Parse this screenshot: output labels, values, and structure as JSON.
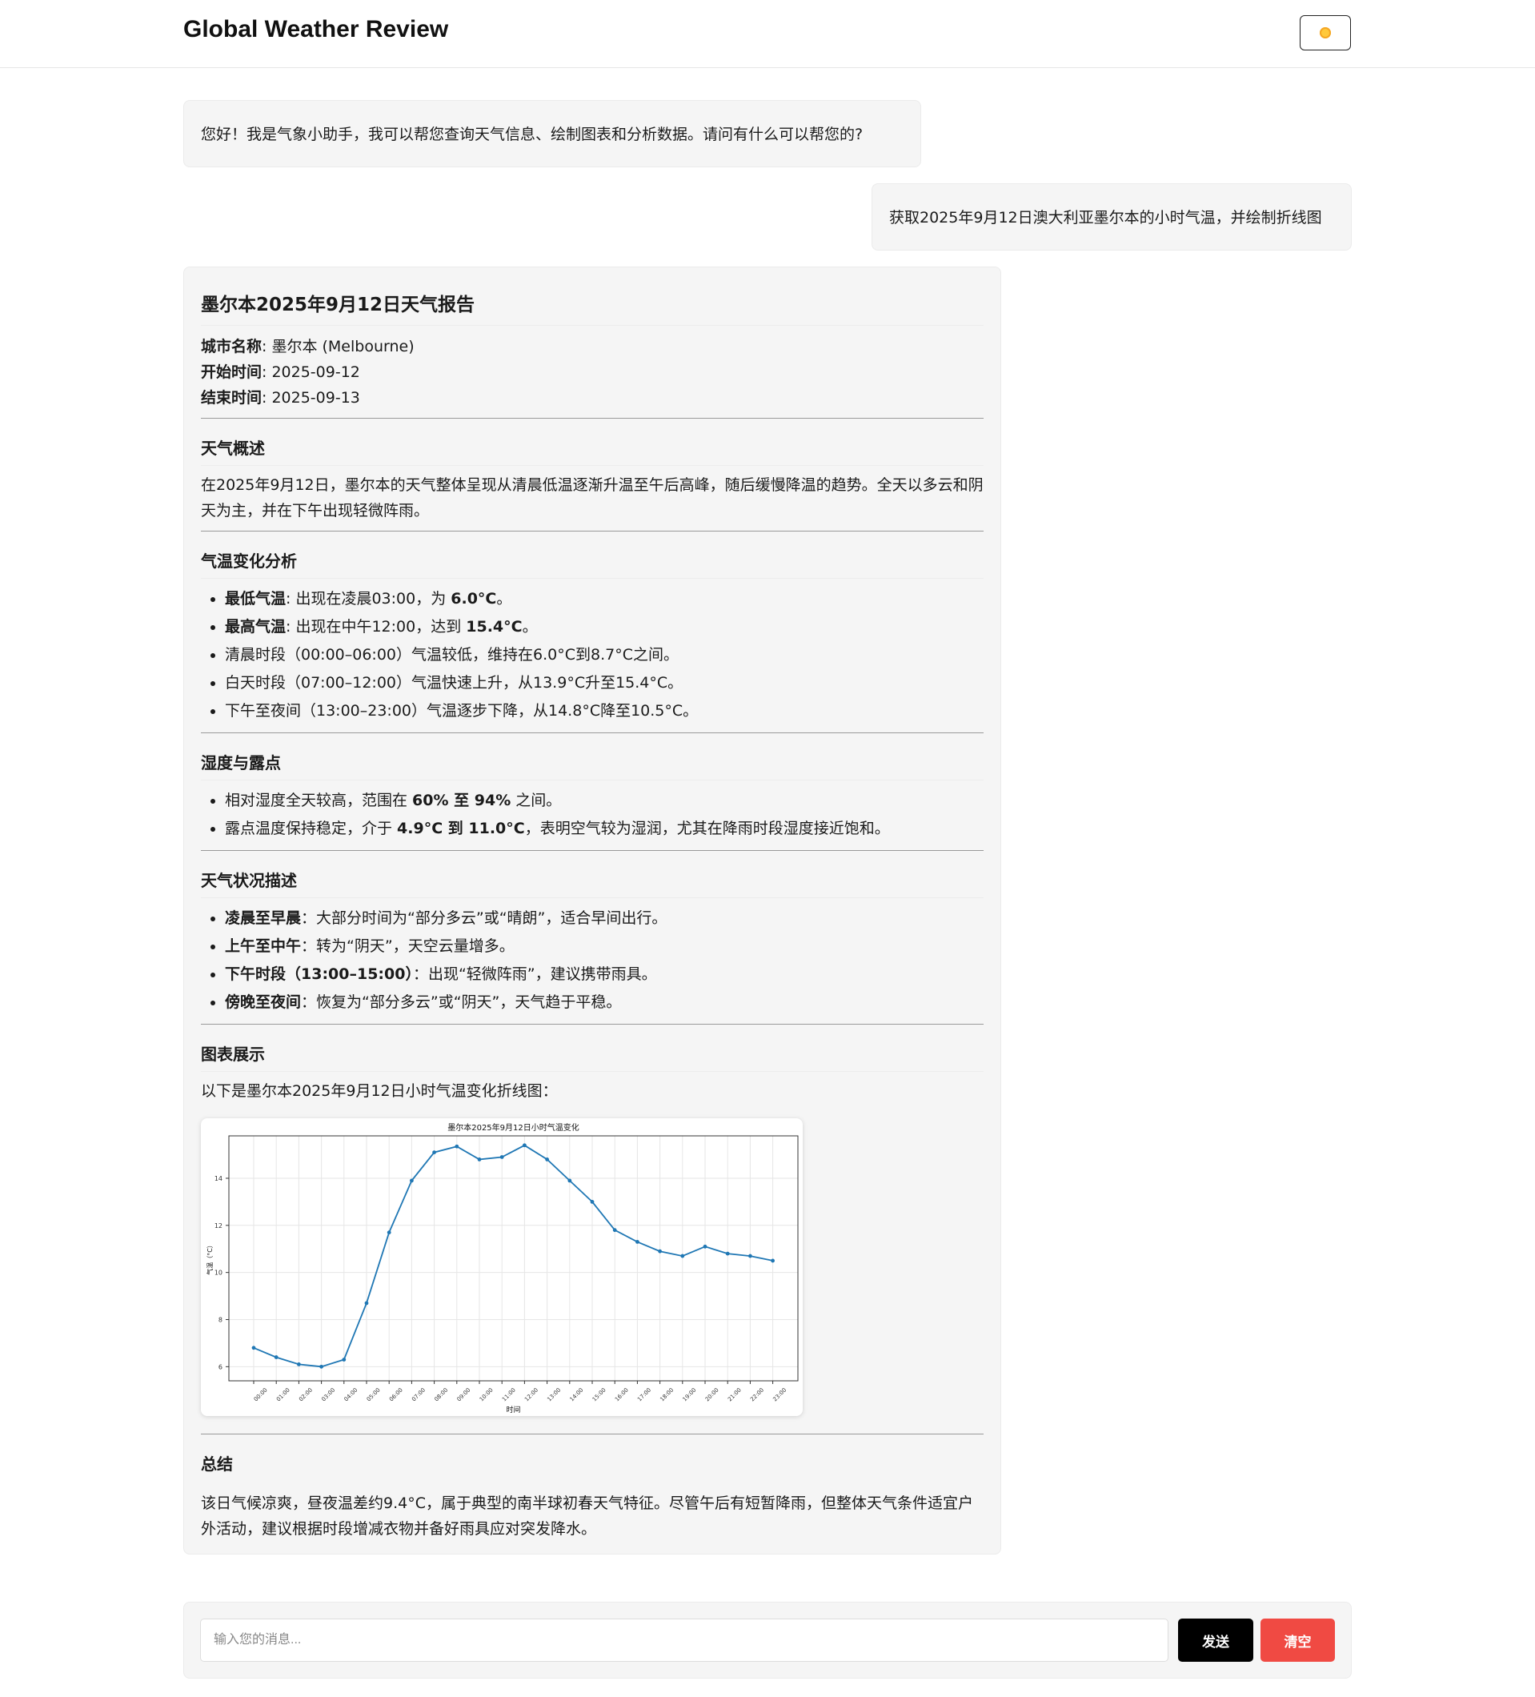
{
  "header": {
    "title": "Global Weather Review",
    "theme_icon": "sun-icon"
  },
  "messages": {
    "assistant_greeting": "您好！我是气象小助手，我可以帮您查询天气信息、绘制图表和分析数据。请问有什么可以帮您的?",
    "user_query": "获取2025年9月12日澳大利亚墨尔本的小时气温，并绘制折线图"
  },
  "report": {
    "title": "墨尔本2025年9月12日天气报告",
    "meta": [
      {
        "label": "城市名称",
        "value": ": 墨尔本 (Melbourne)"
      },
      {
        "label": "开始时间",
        "value": ": 2025-09-12"
      },
      {
        "label": "结束时间",
        "value": ": 2025-09-13"
      }
    ],
    "overview": {
      "title": "天气概述",
      "text": "在2025年9月12日，墨尔本的天气整体呈现从清晨低温逐渐升温至午后高峰，随后缓慢降温的趋势。全天以多云和阴天为主，并在下午出现轻微阵雨。"
    },
    "temperature": {
      "title": "气温变化分析",
      "items": [
        {
          "bold": "最低气温",
          "text": ": 出现在凌晨03:00，为 ",
          "bold2": "6.0°C",
          "tail": "。"
        },
        {
          "bold": "最高气温",
          "text": ": 出现在中午12:00，达到 ",
          "bold2": "15.4°C",
          "tail": "。"
        },
        {
          "bold": "",
          "text": "清晨时段（00:00–06:00）气温较低，维持在6.0°C到8.7°C之间。",
          "bold2": "",
          "tail": ""
        },
        {
          "bold": "",
          "text": "白天时段（07:00–12:00）气温快速上升，从13.9°C升至15.4°C。",
          "bold2": "",
          "tail": ""
        },
        {
          "bold": "",
          "text": "下午至夜间（13:00–23:00）气温逐步下降，从14.8°C降至10.5°C。",
          "bold2": "",
          "tail": ""
        }
      ]
    },
    "humidity": {
      "title": "湿度与露点",
      "items": [
        {
          "pre": "相对湿度全天较高，范围在 ",
          "bold": "60% 至 94%",
          "tail": " 之间。"
        },
        {
          "pre": "露点温度保持稳定，介于 ",
          "bold": "4.9°C 到 11.0°C",
          "tail": "，表明空气较为湿润，尤其在降雨时段湿度接近饱和。"
        }
      ]
    },
    "conditions": {
      "title": "天气状况描述",
      "items": [
        {
          "bold": "凌晨至早晨",
          "text": "：大部分时间为“部分多云”或“晴朗”，适合早间出行。"
        },
        {
          "bold": "上午至中午",
          "text": "：转为“阴天”，天空云量增多。"
        },
        {
          "bold": "下午时段（13:00–15:00）",
          "text": "：出现“轻微阵雨”，建议携带雨具。"
        },
        {
          "bold": "傍晚至夜间",
          "text": "：恢复为“部分多云”或“阴天”，天气趋于平稳。"
        }
      ]
    },
    "chart_section": {
      "title": "图表展示",
      "intro": "以下是墨尔本2025年9月12日小时气温变化折线图："
    },
    "summary": {
      "title": "总结",
      "text": "该日气候凉爽，昼夜温差约9.4°C，属于典型的南半球初春天气特征。尽管午后有短暂降雨，但整体天气条件适宜户外活动，建议根据时段增减衣物并备好雨具应对突发降水。"
    }
  },
  "chart_data": {
    "type": "line",
    "title": "墨尔本2025年9月12日小时气温变化",
    "xlabel": "时间",
    "ylabel": "气温（°C）",
    "categories": [
      "00:00",
      "01:00",
      "02:00",
      "03:00",
      "04:00",
      "05:00",
      "06:00",
      "07:00",
      "08:00",
      "09:00",
      "10:00",
      "11:00",
      "12:00",
      "13:00",
      "14:00",
      "15:00",
      "16:00",
      "17:00",
      "18:00",
      "19:00",
      "20:00",
      "21:00",
      "22:00",
      "23:00"
    ],
    "series": [
      {
        "values": [
          6.8,
          6.4,
          6.1,
          6.0,
          6.3,
          8.7,
          11.7,
          13.9,
          15.1,
          15.35,
          14.8,
          14.9,
          15.4,
          14.8,
          13.9,
          13.0,
          11.8,
          11.3,
          10.9,
          10.7,
          11.1,
          10.8,
          10.7,
          10.5
        ]
      }
    ],
    "ylim": [
      5.4,
      15.8
    ],
    "yticks": [
      6,
      8,
      10,
      12,
      14
    ],
    "grid": true,
    "line_color": "#1f77b4"
  },
  "input": {
    "placeholder": "输入您的消息...",
    "value": ""
  },
  "buttons": {
    "send": "发送",
    "clear": "清空"
  }
}
